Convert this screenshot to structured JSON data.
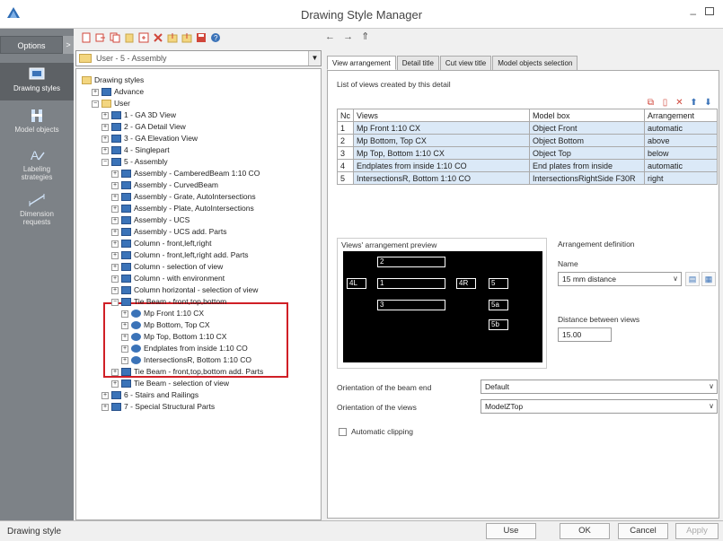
{
  "window": {
    "title": "Drawing Style Manager",
    "minimize": "–"
  },
  "sidebar": {
    "options_label": "Options",
    "toggle_label": ">",
    "items": [
      {
        "label": "Drawing styles",
        "icon": "drawing-styles-icon"
      },
      {
        "label": "Model objects",
        "icon": "model-objects-icon"
      },
      {
        "label": "Labeling strategies",
        "icon": "labeling-icon"
      },
      {
        "label": "Dimension requests",
        "icon": "dimension-icon"
      }
    ]
  },
  "toolbar": {
    "icons": [
      "new-icon",
      "export-icon",
      "copy-icon",
      "paste-icon",
      "duplicate-icon",
      "delete-icon",
      "import-icon",
      "export-all-icon",
      "save-icon",
      "help-icon"
    ]
  },
  "nav": {
    "back": "←",
    "forward": "→",
    "up": "⇑"
  },
  "combo": {
    "value": "User - 5 - Assembly",
    "arrow": "▼"
  },
  "tree": {
    "rows": [
      {
        "indent": 0,
        "expander": "",
        "icon": "folder",
        "label": "Drawing styles"
      },
      {
        "indent": 1,
        "expander": "+",
        "icon": "advance",
        "label": "Advance"
      },
      {
        "indent": 1,
        "expander": "−",
        "icon": "folder",
        "label": "User"
      },
      {
        "indent": 2,
        "expander": "+",
        "icon": "view",
        "label": "1 - GA 3D View"
      },
      {
        "indent": 2,
        "expander": "+",
        "icon": "view",
        "label": "2 - GA Detail View"
      },
      {
        "indent": 2,
        "expander": "+",
        "icon": "view",
        "label": "3 - GA Elevation View"
      },
      {
        "indent": 2,
        "expander": "+",
        "icon": "view",
        "label": "4 - Singlepart"
      },
      {
        "indent": 2,
        "expander": "−",
        "icon": "view",
        "label": "5 - Assembly"
      },
      {
        "indent": 3,
        "expander": "+",
        "icon": "view",
        "label": "Assembly - CamberedBeam 1:10 CO"
      },
      {
        "indent": 3,
        "expander": "+",
        "icon": "view",
        "label": "Assembly - CurvedBeam"
      },
      {
        "indent": 3,
        "expander": "+",
        "icon": "view",
        "label": "Assembly - Grate, AutoIntersections"
      },
      {
        "indent": 3,
        "expander": "+",
        "icon": "view",
        "label": "Assembly - Plate, AutoIntersections"
      },
      {
        "indent": 3,
        "expander": "+",
        "icon": "view",
        "label": "Assembly - UCS"
      },
      {
        "indent": 3,
        "expander": "+",
        "icon": "view",
        "label": "Assembly - UCS add. Parts"
      },
      {
        "indent": 3,
        "expander": "+",
        "icon": "view",
        "label": "Column - front,left,right"
      },
      {
        "indent": 3,
        "expander": "+",
        "icon": "view",
        "label": "Column - front,left,right add. Parts"
      },
      {
        "indent": 3,
        "expander": "+",
        "icon": "view",
        "label": "Column - selection of view"
      },
      {
        "indent": 3,
        "expander": "+",
        "icon": "view",
        "label": "Column - with environment"
      },
      {
        "indent": 3,
        "expander": "+",
        "icon": "view",
        "label": "Column horizontal - selection of view"
      },
      {
        "indent": 3,
        "expander": "−",
        "icon": "view",
        "label": "Tie Beam - front,top,bottom"
      },
      {
        "indent": 4,
        "expander": "+",
        "icon": "eye",
        "label": "Mp Front 1:10 CX"
      },
      {
        "indent": 4,
        "expander": "+",
        "icon": "eye",
        "label": "Mp Bottom, Top CX"
      },
      {
        "indent": 4,
        "expander": "+",
        "icon": "eye",
        "label": "Mp Top, Bottom 1:10 CX"
      },
      {
        "indent": 4,
        "expander": "+",
        "icon": "eye",
        "label": "Endplates from inside 1:10 CO"
      },
      {
        "indent": 4,
        "expander": "+",
        "icon": "eye",
        "label": "IntersectionsR, Bottom 1:10 CO"
      },
      {
        "indent": 3,
        "expander": "+",
        "icon": "view",
        "label": "Tie Beam - front,top,bottom add. Parts"
      },
      {
        "indent": 3,
        "expander": "+",
        "icon": "view",
        "label": "Tie Beam - selection of view"
      },
      {
        "indent": 2,
        "expander": "+",
        "icon": "view",
        "label": "6 - Stairs and Railings"
      },
      {
        "indent": 2,
        "expander": "+",
        "icon": "view",
        "label": "7 - Special Structural Parts"
      }
    ]
  },
  "tabs": [
    "View arrangement",
    "Detail title",
    "Cut view title",
    "Model objects selection"
  ],
  "views_group": {
    "label": "List of views created by this detail",
    "columns": [
      "Nc",
      "Views",
      "Model box",
      "Arrangement"
    ],
    "rows": [
      [
        "1",
        "Mp Front 1:10 CX",
        "Object Front",
        "automatic"
      ],
      [
        "2",
        "Mp Bottom, Top CX",
        "Object Bottom",
        "above"
      ],
      [
        "3",
        "Mp Top, Bottom 1:10 CX",
        "Object Top",
        "below"
      ],
      [
        "4",
        "Endplates from inside 1:10 CO",
        "End plates from inside",
        "automatic"
      ],
      [
        "5",
        "IntersectionsR, Bottom 1:10 CO",
        "IntersectionsRightSide F30R",
        "right"
      ]
    ],
    "tools": [
      "copy-icon",
      "new-icon",
      "delete-icon",
      "move-up-icon",
      "move-down-icon"
    ]
  },
  "preview": {
    "label": "Views' arrangement preview",
    "boxes": [
      {
        "text": "2"
      },
      {
        "text": "4L"
      },
      {
        "text": "1"
      },
      {
        "text": "4R"
      },
      {
        "text": "5"
      },
      {
        "text": "3"
      },
      {
        "text": "5a"
      },
      {
        "text": "5b"
      }
    ]
  },
  "arrangement": {
    "label": "Arrangement definition",
    "name_label": "Name",
    "name_value": "15 mm distance",
    "distance_label": "Distance between views",
    "distance_value": "15.00"
  },
  "orientation": {
    "beam_end_label": "Orientation of the beam end",
    "beam_end_value": "Default",
    "views_label": "Orientation of the views",
    "views_value": "ModelZTop"
  },
  "clipping": {
    "label": "Automatic clipping",
    "checked": false
  },
  "status": {
    "text": "Drawing style"
  },
  "buttons": {
    "use": "Use",
    "ok": "OK",
    "cancel": "Cancel",
    "apply": "Apply"
  },
  "colors": {
    "sidebar": "#7d8287",
    "table_row": "#dbe9f7",
    "highlight": "#d01f26",
    "preview_bg": "#000000"
  }
}
